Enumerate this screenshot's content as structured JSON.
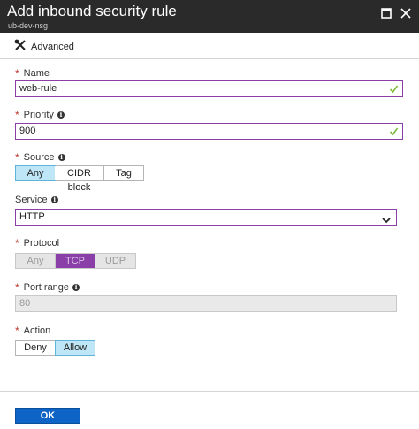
{
  "window": {
    "title": "Add inbound security rule",
    "subtitle": "ub-dev-nsg"
  },
  "toolbar": {
    "advanced_label": "Advanced"
  },
  "form": {
    "name": {
      "label": "Name",
      "value": "web-rule",
      "required": true
    },
    "priority": {
      "label": "Priority",
      "value": "900",
      "required": true
    },
    "source": {
      "label": "Source",
      "options": [
        "Any",
        "CIDR block",
        "Tag"
      ],
      "selected": "Any",
      "required": true
    },
    "service": {
      "label": "Service",
      "value": "HTTP"
    },
    "protocol": {
      "label": "Protocol",
      "options": [
        "Any",
        "TCP",
        "UDP"
      ],
      "selected": "TCP",
      "disabled": true,
      "required": true
    },
    "port_range": {
      "label": "Port range",
      "value": "80",
      "disabled": true,
      "required": true
    },
    "action": {
      "label": "Action",
      "options": [
        "Deny",
        "Allow"
      ],
      "selected": "Allow",
      "required": true
    }
  },
  "footer": {
    "ok_label": "OK"
  },
  "colors": {
    "titlebar": "#2a2a2a",
    "accent_border": "#8a3ea8",
    "selected_option": "#bfe6f7",
    "ok_button": "#0d63c6",
    "required_asterisk": "#c0392b",
    "valid_check": "#7db93b"
  },
  "icons": {
    "advanced": "wrench-screwdriver-icon",
    "maximize": "maximize-icon",
    "close": "close-icon",
    "valid": "checkmark-icon",
    "info": "info-icon",
    "dropdown": "chevron-down-icon"
  }
}
